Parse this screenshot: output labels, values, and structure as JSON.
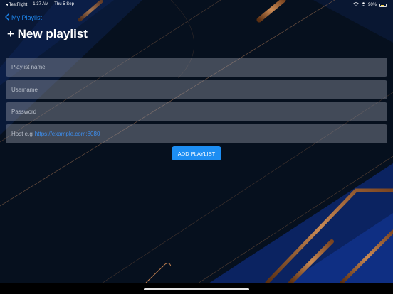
{
  "status_bar": {
    "back_app": "◂ TestFlight",
    "time": "1:37 AM",
    "date": "Thu 5 Sep",
    "battery": "90%",
    "battery_level": 0.9
  },
  "nav": {
    "back_label": "My Playlist"
  },
  "page": {
    "title": "+ New playlist"
  },
  "form": {
    "playlist_name_placeholder": "Playlist name",
    "username_placeholder": "Username",
    "password_placeholder": "Password",
    "host_prefix": "Host e.g",
    "host_example": "https://example.com:8080",
    "submit_label": "ADD PLAYLIST"
  },
  "colors": {
    "accent": "#1d8ef3",
    "background": "#06101e"
  }
}
